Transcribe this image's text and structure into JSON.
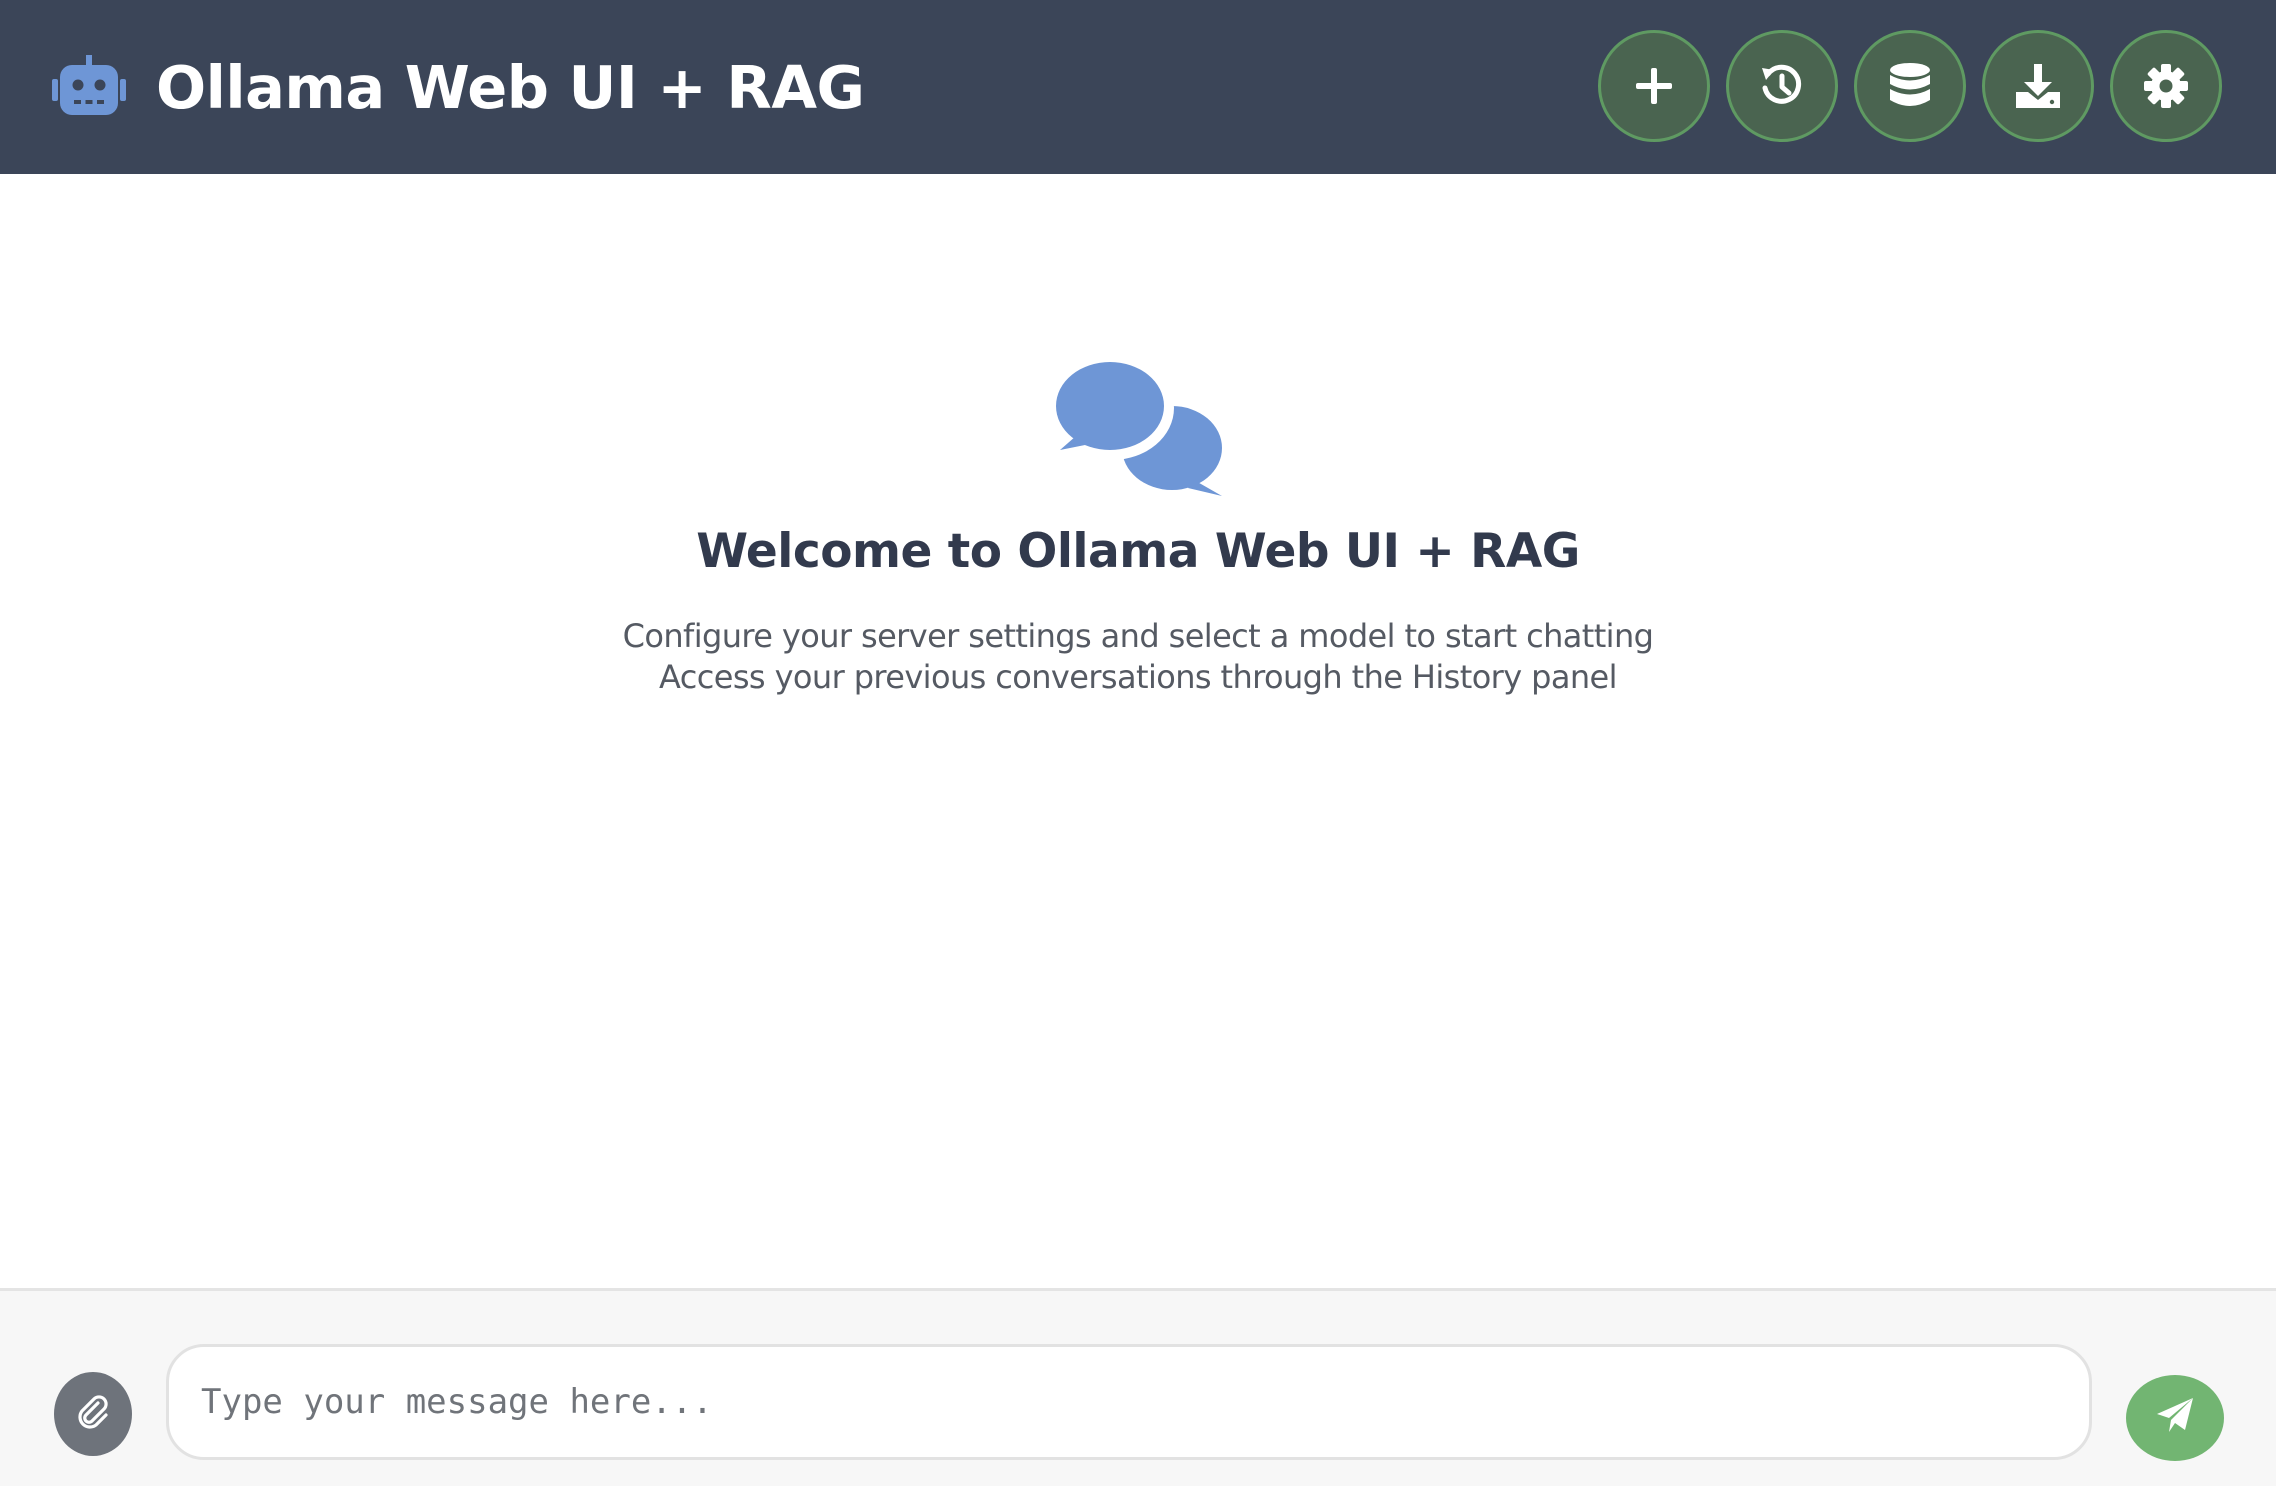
{
  "app": {
    "title": "Ollama Web UI + RAG",
    "logo_icon": "robot-icon"
  },
  "header_actions": [
    {
      "name": "new-chat-button",
      "icon": "plus-icon"
    },
    {
      "name": "history-button",
      "icon": "history-icon"
    },
    {
      "name": "knowledge-base-button",
      "icon": "database-icon"
    },
    {
      "name": "download-button",
      "icon": "download-icon"
    },
    {
      "name": "settings-button",
      "icon": "gear-icon"
    }
  ],
  "welcome": {
    "icon": "comments-icon",
    "title": "Welcome to Ollama Web UI + RAG",
    "line1": "Configure your server settings and select a model to start chatting",
    "line2": "Access your previous conversations through the History panel"
  },
  "composer": {
    "attach_icon": "paperclip-icon",
    "placeholder": "Type your message here...",
    "value": "",
    "send_icon": "send-icon"
  },
  "colors": {
    "header_bg": "#3b4558",
    "accent_blue": "#6e96d6",
    "action_button_bg": "#4a6450",
    "action_button_border": "#5f9a62",
    "send_button_bg": "#72b572",
    "attach_button_bg": "#6e737b"
  }
}
